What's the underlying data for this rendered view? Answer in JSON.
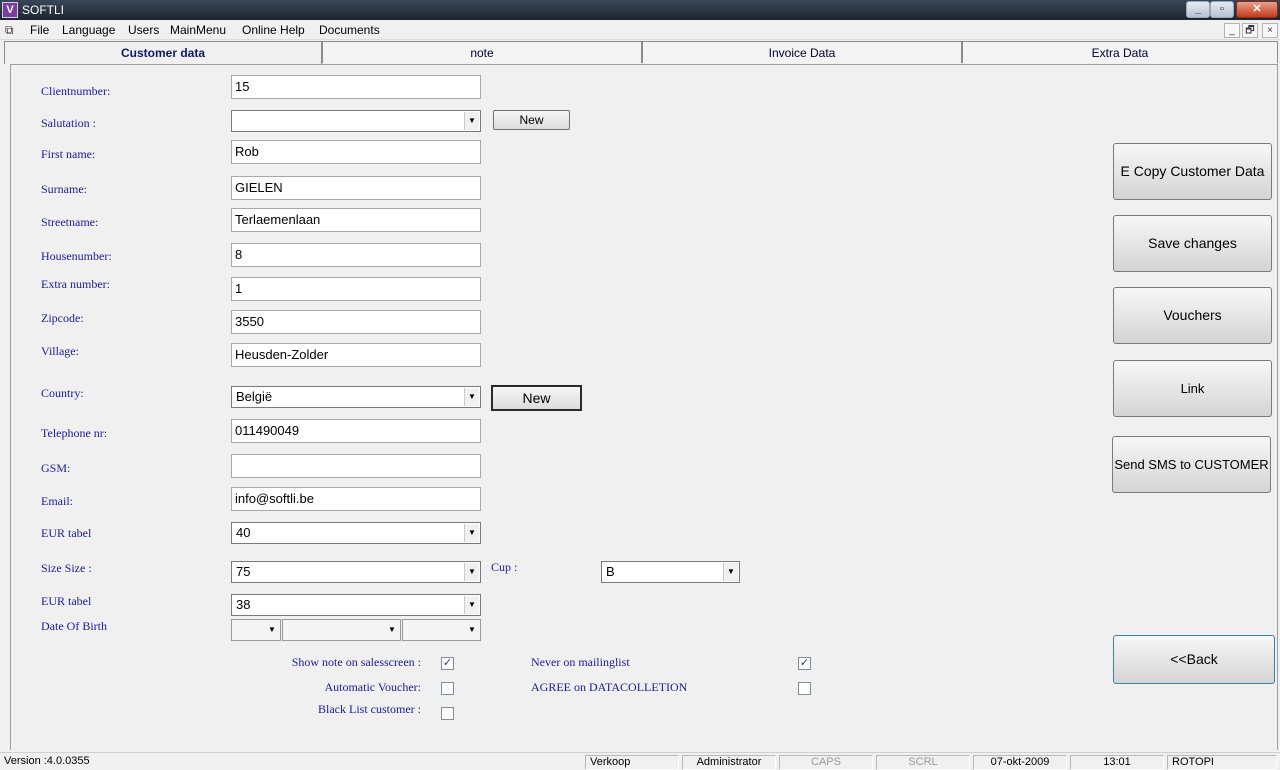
{
  "window": {
    "title": "SOFTLI",
    "app_icon": "softli-logo-icon"
  },
  "menu": {
    "items": [
      "File",
      "Language",
      "Users",
      "MainMenu",
      "Online Help",
      "Documents"
    ],
    "mdi_buttons": [
      "_",
      "🗗",
      "×"
    ]
  },
  "tabs": [
    "Customer data",
    "note",
    "Invoice Data",
    "Extra Data"
  ],
  "form": {
    "clientnumber": {
      "label": "Clientnumber:",
      "value": "15"
    },
    "salutation": {
      "label": "Salutation :",
      "value": "",
      "new_button": "New"
    },
    "first_name": {
      "label": "First name:",
      "value": "Rob"
    },
    "surname": {
      "label": "Surname:",
      "value": "GIELEN"
    },
    "streetname": {
      "label": "Streetname:",
      "value": "Terlaemenlaan"
    },
    "housenumber": {
      "label": "Housenumber:",
      "value": "8"
    },
    "extra_number": {
      "label": "Extra number:",
      "value": "1"
    },
    "zipcode": {
      "label": "Zipcode:",
      "value": "3550"
    },
    "village": {
      "label": "Village:",
      "value": "Heusden-Zolder"
    },
    "country": {
      "label": "Country:",
      "value": "België",
      "new_button": "New"
    },
    "telephone": {
      "label": "Telephone nr:",
      "value": "011490049"
    },
    "gsm": {
      "label": "GSM:",
      "value": ""
    },
    "email": {
      "label": "Email:",
      "value": "info@softli.be"
    },
    "eur_tabel_1": {
      "label": "EUR tabel",
      "value": "40"
    },
    "size": {
      "label": "Size Size :",
      "value": "75"
    },
    "cup": {
      "label": "Cup :",
      "value": "B"
    },
    "eur_tabel_2": {
      "label": "EUR tabel",
      "value": "38"
    },
    "date_of_birth": {
      "label": "Date Of Birth"
    }
  },
  "checkboxes": {
    "show_note": {
      "label": "Show note on salesscreen :",
      "checked": true
    },
    "automatic_voucher": {
      "label": "Automatic Voucher:",
      "checked": false
    },
    "black_list": {
      "label": "Black List customer :",
      "checked": false
    },
    "never_mailing": {
      "label": "Never on mailinglist",
      "checked": true
    },
    "agree_data": {
      "label": "AGREE on DATACOLLETION",
      "checked": false
    },
    "check_mark": "✓"
  },
  "side_buttons": {
    "copy": "E  Copy Customer Data",
    "save": "Save changes",
    "vouchers": "Vouchers",
    "link": "Link",
    "sms": "Send SMS to CUSTOMER",
    "back": "<<Back"
  },
  "status": {
    "version": "Version :4.0.0355",
    "mode": "Verkoop",
    "user": "Administrator",
    "caps": "CAPS",
    "scrl": "SCRL",
    "date": "07-okt-2009",
    "time": "13:01",
    "station": "ROTOPI"
  },
  "colors": {
    "label_blue": "#1a1a9a",
    "titlebar": "#1c2430",
    "close_red": "#c33b1d"
  }
}
